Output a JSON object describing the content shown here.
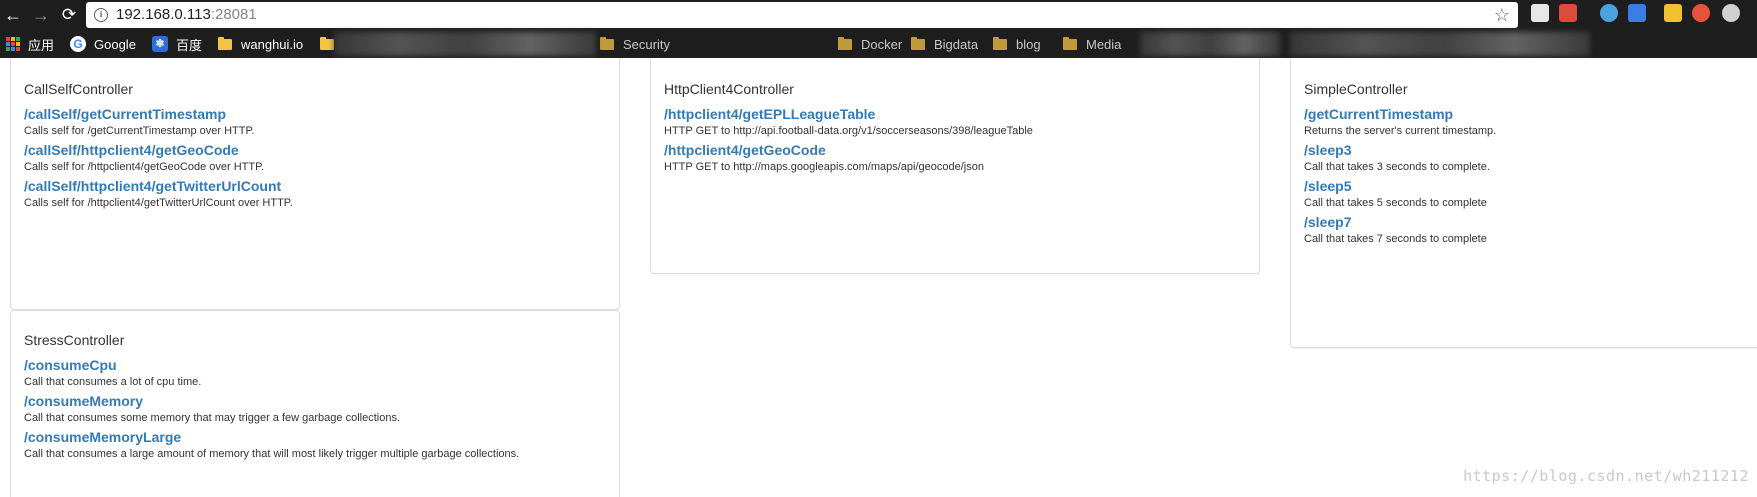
{
  "browser": {
    "nav": {
      "back": "←",
      "forward": "→",
      "reload": "⟳"
    },
    "address": {
      "host": "192.168.0.113",
      "port": ":28081"
    },
    "bookmarks": [
      {
        "label": "应用",
        "icon": "apps-icon"
      },
      {
        "label": "Google",
        "icon": "google-icon"
      },
      {
        "label": "百度",
        "icon": "baidu-icon"
      },
      {
        "label": "wanghui.io",
        "icon": "folder-icon"
      },
      {
        "label": "Security",
        "icon": "folder-icon"
      },
      {
        "label": "Docker",
        "icon": "folder-icon"
      },
      {
        "label": "Bigdata",
        "icon": "folder-icon"
      },
      {
        "label": "blog",
        "icon": "folder-icon"
      },
      {
        "label": "Media",
        "icon": "folder-icon"
      }
    ],
    "extensions": [
      {
        "icon": "chat-icon",
        "color": "#e8e8e8"
      },
      {
        "icon": "todoist-icon",
        "color": "#db4c3f"
      },
      {
        "icon": "bird-icon",
        "color": "#4aa3df"
      },
      {
        "icon": "translate-icon",
        "color": "#3d7be6"
      },
      {
        "icon": "notes-icon",
        "color": "#f2c12e"
      },
      {
        "icon": "infinity-icon",
        "color": "#e8523a"
      },
      {
        "icon": "person-icon",
        "color": "#d0d0d0"
      }
    ]
  },
  "panels": [
    {
      "title": "CallSelfController",
      "endpoints": [
        {
          "path": "/callSelf/getCurrentTimestamp",
          "desc": "Calls self for /getCurrentTimestamp over HTTP."
        },
        {
          "path": "/callSelf/httpclient4/getGeoCode",
          "desc": "Calls self for /httpclient4/getGeoCode over HTTP."
        },
        {
          "path": "/callSelf/httpclient4/getTwitterUrlCount",
          "desc": "Calls self for /httpclient4/getTwitterUrlCount over HTTP."
        }
      ]
    },
    {
      "title": "HttpClient4Controller",
      "endpoints": [
        {
          "path": "/httpclient4/getEPLLeagueTable",
          "desc": "HTTP GET to http://api.football-data.org/v1/soccerseasons/398/leagueTable"
        },
        {
          "path": "/httpclient4/getGeoCode",
          "desc": "HTTP GET to http://maps.googleapis.com/maps/api/geocode/json"
        }
      ]
    },
    {
      "title": "SimpleController",
      "endpoints": [
        {
          "path": "/getCurrentTimestamp",
          "desc": "Returns the server's current timestamp."
        },
        {
          "path": "/sleep3",
          "desc": "Call that takes 3 seconds to complete."
        },
        {
          "path": "/sleep5",
          "desc": "Call that takes 5 seconds to complete"
        },
        {
          "path": "/sleep7",
          "desc": "Call that takes 7 seconds to complete"
        }
      ]
    },
    {
      "title": "StressController",
      "endpoints": [
        {
          "path": "/consumeCpu",
          "desc": "Call that consumes a lot of cpu time."
        },
        {
          "path": "/consumeMemory",
          "desc": "Call that consumes some memory that may trigger a few garbage collections."
        },
        {
          "path": "/consumeMemoryLarge",
          "desc": "Call that consumes a large amount of memory that will most likely trigger multiple garbage collections."
        }
      ]
    }
  ],
  "watermark": "https://blog.csdn.net/wh211212"
}
